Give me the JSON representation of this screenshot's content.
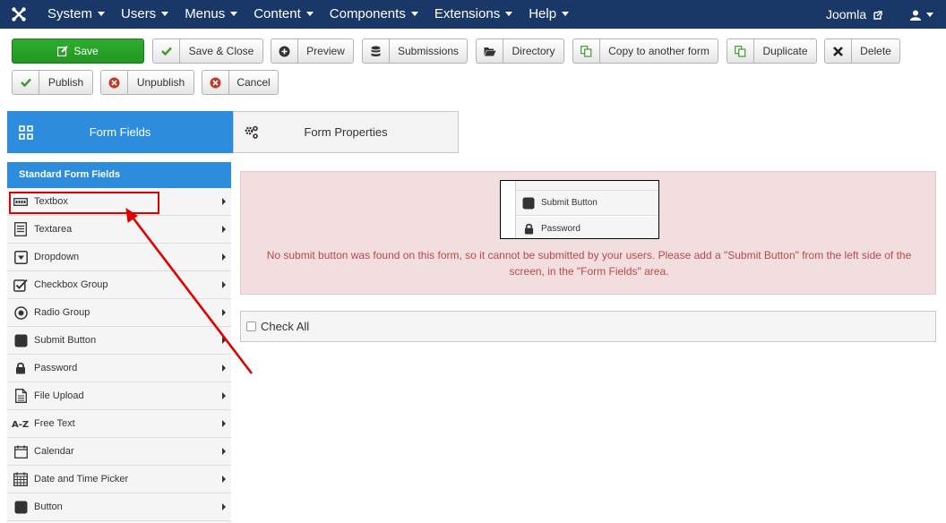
{
  "navbar": {
    "menu": [
      "System",
      "Users",
      "Menus",
      "Content",
      "Components",
      "Extensions",
      "Help"
    ],
    "site_link": "Joomla",
    "colors": {
      "background": "#1a3867"
    }
  },
  "toolbar": {
    "save": "Save",
    "save_close": "Save & Close",
    "preview": "Preview",
    "submissions": "Submissions",
    "directory": "Directory",
    "copy": "Copy to another form",
    "duplicate": "Duplicate",
    "delete": "Delete",
    "publish": "Publish",
    "unpublish": "Unpublish",
    "cancel": "Cancel",
    "colors": {
      "save": "#229622",
      "accent_check": "#3c9a2d",
      "accent_x": "#c0392b"
    }
  },
  "tabs": {
    "form_fields": "Form Fields",
    "form_properties": "Form Properties",
    "colors": {
      "active": "#2d8cdb"
    }
  },
  "sidebar": {
    "heading": "Standard Form Fields",
    "items": [
      {
        "label": "Textbox",
        "icon": "textbox-icon"
      },
      {
        "label": "Textarea",
        "icon": "textarea-icon"
      },
      {
        "label": "Dropdown",
        "icon": "dropdown-icon"
      },
      {
        "label": "Checkbox Group",
        "icon": "checkbox-icon"
      },
      {
        "label": "Radio Group",
        "icon": "radio-icon"
      },
      {
        "label": "Submit Button",
        "icon": "square-icon"
      },
      {
        "label": "Password",
        "icon": "lock-icon"
      },
      {
        "label": "File Upload",
        "icon": "file-icon"
      },
      {
        "label": "Free Text",
        "icon": "a-z-icon"
      },
      {
        "label": "Calendar",
        "icon": "calendar-icon"
      },
      {
        "label": "Date and Time Picker",
        "icon": "calendar-icon"
      },
      {
        "label": "Button",
        "icon": "square-icon"
      }
    ],
    "highlight_color": "#e00000"
  },
  "alert": {
    "thumbnail": {
      "row1": "Submit Button",
      "row2": "Password"
    },
    "message": "No submit button was found on this form, so it cannot be submitted by your users. Please add a \"Submit Button\" from the left side of the screen, in the \"Form Fields\" area.",
    "colors": {
      "background": "#f2dede",
      "text": "#b94a48"
    }
  },
  "check_all": "Check All"
}
